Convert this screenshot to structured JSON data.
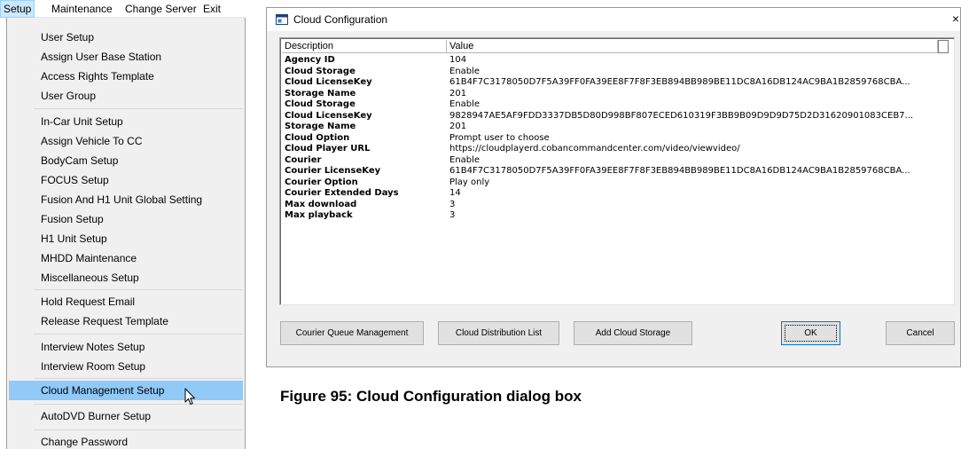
{
  "menubar": {
    "items": [
      "Setup",
      "Maintenance",
      "Change Server",
      "Exit"
    ],
    "active": "Setup"
  },
  "setup_menu": {
    "items": [
      "User Setup",
      "Assign User Base Station",
      "Access Rights Template",
      "User Group",
      "In-Car Unit Setup",
      "Assign Vehicle To CC",
      "BodyCam Setup",
      "FOCUS Setup",
      "Fusion And H1 Unit Global Setting",
      "Fusion Setup",
      "H1 Unit Setup",
      "MHDD Maintenance",
      "Miscellaneous Setup",
      "Hold Request Email",
      "Release Request Template",
      "Interview Notes Setup",
      "Interview Room Setup",
      "Cloud Management Setup",
      "AutoDVD Burner Setup",
      "Change Password"
    ],
    "highlighted": "Cloud Management Setup",
    "cursor_icon": "mouse-pointer-icon"
  },
  "dialog": {
    "title": "Cloud Configuration",
    "title_icon": "app-window-icon",
    "close_glyph": "×",
    "columns": [
      "Description",
      "Value"
    ],
    "rows": [
      {
        "description": "Agency ID",
        "value": "104"
      },
      {
        "description": "Cloud Storage",
        "value": "Enable"
      },
      {
        "description": "Cloud LicenseKey",
        "value": "61B4F7C3178050D7F5A39FF0FA39EE8F7F8F3EB894BB989BE11DC8A16DB124AC9BA1B2859768CBA..."
      },
      {
        "description": "Storage Name",
        "value": "201"
      },
      {
        "description": "Cloud Storage",
        "value": "Enable"
      },
      {
        "description": "Cloud LicenseKey",
        "value": "9828947AE5AF9FDD3337DB5D80D998BF807ECED610319F3BB9B09D9D9D75D2D31620901083CEB7..."
      },
      {
        "description": "Storage Name",
        "value": "201"
      },
      {
        "description": "Cloud Option",
        "value": "Prompt user to choose"
      },
      {
        "description": "Cloud Player URL",
        "value": "https://cloudplayerd.cobancommandcenter.com/video/viewvideo/"
      },
      {
        "description": "Courier",
        "value": "Enable"
      },
      {
        "description": "Courier LicenseKey",
        "value": "61B4F7C3178050D7F5A39FF0FA39EE8F7F8F3EB894BB989BE11DC8A16DB124AC9BA1B2859768CBA..."
      },
      {
        "description": "Courier Option",
        "value": "Play only"
      },
      {
        "description": "Courier Extended Days",
        "value": "14"
      },
      {
        "description": "Max download",
        "value": "3"
      },
      {
        "description": "Max playback",
        "value": "3"
      }
    ],
    "buttons": {
      "courier_queue": "Courier Queue Management",
      "distribution_list": "Cloud Distribution List",
      "add_storage": "Add Cloud Storage",
      "ok": "OK",
      "cancel": "Cancel"
    }
  },
  "caption": "Figure 95: Cloud Configuration dialog box"
}
